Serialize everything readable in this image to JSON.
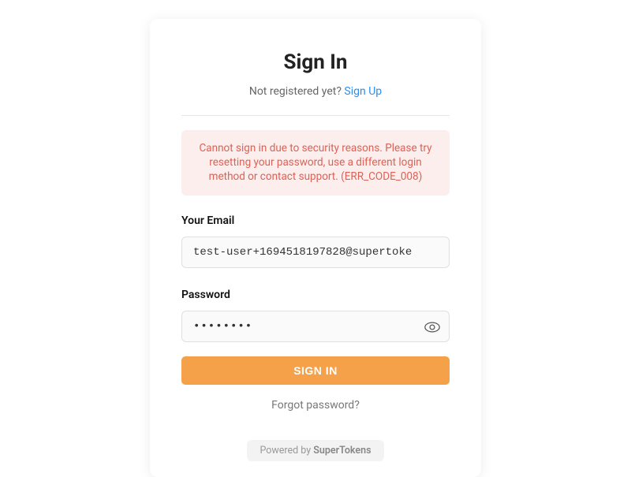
{
  "header": {
    "title": "Sign In",
    "subtitle_prefix": "Not registered yet? ",
    "signup_label": "Sign Up"
  },
  "error": {
    "message": "Cannot sign in due to security reasons. Please try resetting your password, use a different login method or contact support. (ERR_CODE_008)"
  },
  "form": {
    "email_label": "Your Email",
    "email_value": "test-user+1694518197828@supertoke",
    "password_label": "Password",
    "password_value": "••••••••",
    "submit_label": "SIGN IN",
    "forgot_label": "Forgot password?"
  },
  "footer": {
    "prefix": "Powered by ",
    "brand": "SuperTokens"
  },
  "colors": {
    "primary": "#f5a14a",
    "link": "#2a8ef1",
    "error_bg": "#fceeec",
    "error_text": "#e06055"
  }
}
